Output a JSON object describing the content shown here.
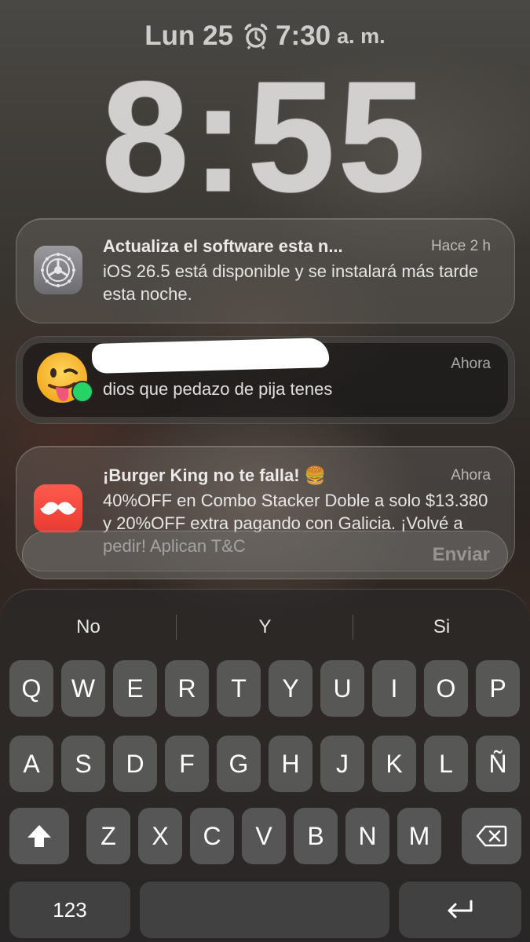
{
  "status": {
    "date": "Lun 25",
    "alarm_time": "7:30",
    "alarm_ampm": "a. m."
  },
  "clock": "8:55",
  "notifications": [
    {
      "app": "settings-icon",
      "title": "Actualiza el software esta n...",
      "time": "Hace 2 h",
      "body": "iOS 26.5 está disponible y se instalará más tarde esta noche."
    },
    {
      "app": "whatsapp-icon",
      "title": "",
      "time": "Ahora",
      "body": "dios que pedazo de pija tenes"
    },
    {
      "app": "burger-king-icon",
      "title": "¡Burger King no te falla! 🍔",
      "time": "Ahora",
      "body": "40%OFF en Combo Stacker Doble a solo $13.380 y 20%OFF extra pagando con Galicia. ¡Volvé a pedir! Aplican T&C"
    }
  ],
  "reply": {
    "send_label": "Enviar"
  },
  "keyboard": {
    "suggestions": [
      "No",
      "Y",
      "Si"
    ],
    "row1": [
      "Q",
      "W",
      "E",
      "R",
      "T",
      "Y",
      "U",
      "I",
      "O",
      "P"
    ],
    "row2": [
      "A",
      "S",
      "D",
      "F",
      "G",
      "H",
      "J",
      "K",
      "L",
      "Ñ"
    ],
    "row3": [
      "Z",
      "X",
      "C",
      "V",
      "B",
      "N",
      "M"
    ],
    "numbers_label": "123"
  }
}
